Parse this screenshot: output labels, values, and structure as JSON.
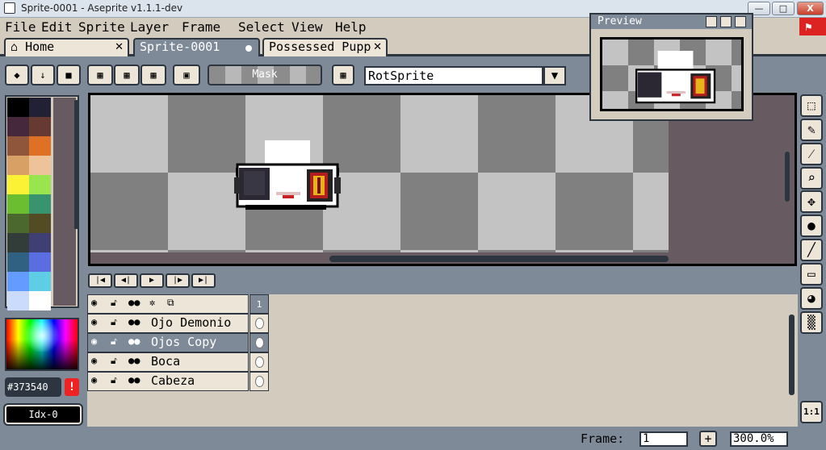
{
  "window": {
    "title": "Sprite-0001 - Aseprite v1.1.1-dev",
    "minimize": "—",
    "maximize": "□",
    "close": "X"
  },
  "menu": [
    "File",
    "Edit",
    "Sprite",
    "Layer",
    "Frame",
    "Select",
    "View",
    "Help"
  ],
  "tabs": [
    {
      "label": "Home",
      "icon": "home-icon"
    },
    {
      "label": "Sprite-0001",
      "active": true,
      "modified": true
    },
    {
      "label": "Possessed Pupp"
    }
  ],
  "toolbar": {
    "mask_label": "Mask",
    "rotation_algorithm": "RotSprite"
  },
  "preview": {
    "title": "Preview"
  },
  "palette": {
    "colors": [
      "#000000",
      "#222034",
      "#45283c",
      "#663931",
      "#8f563b",
      "#df7126",
      "#d9a066",
      "#eec39a",
      "#fbf236",
      "#99e550",
      "#6abe30",
      "#37946e",
      "#4b692f",
      "#524b24",
      "#323c39",
      "#3f3f74",
      "#306082",
      "#5b6ee1",
      "#639bff",
      "#5fcde4",
      "#cbdbfc",
      "#ffffff"
    ],
    "hex_value": "#373540",
    "index_label": "Idx-0"
  },
  "layers": [
    {
      "name": "Ojo Demonio",
      "active": false
    },
    {
      "name": "Ojos Copy",
      "active": true
    },
    {
      "name": "Boca",
      "active": false
    },
    {
      "name": "Cabeza",
      "active": false
    }
  ],
  "timeline": {
    "frame_number": "1"
  },
  "status": {
    "frame_label": "Frame:",
    "frame_value": "1",
    "zoom": "300.0%",
    "ratio": "1:1"
  },
  "colors": {
    "accent": "#7e8a97",
    "panel": "#d3cbbe",
    "button": "#ece5d8",
    "border": "#2d3640"
  }
}
